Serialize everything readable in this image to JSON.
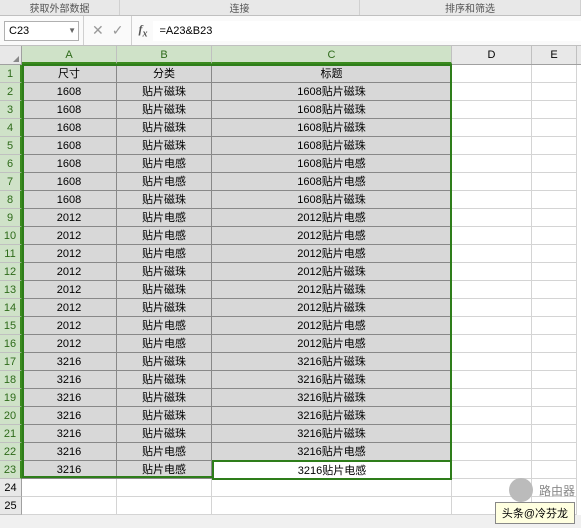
{
  "ribbon": {
    "label1": "获取外部数据",
    "label2": "连接",
    "label3": "排序和筛选"
  },
  "namebox": {
    "value": "C23"
  },
  "formula": {
    "value": "=A23&B23"
  },
  "columns": [
    "A",
    "B",
    "C",
    "D",
    "E"
  ],
  "header_row": {
    "A": "尺寸",
    "B": "分类",
    "C": "标题"
  },
  "rows": [
    {
      "n": 1
    },
    {
      "n": 2,
      "A": "1608",
      "B": "贴片磁珠",
      "C": "1608贴片磁珠"
    },
    {
      "n": 3,
      "A": "1608",
      "B": "贴片磁珠",
      "C": "1608贴片磁珠"
    },
    {
      "n": 4,
      "A": "1608",
      "B": "贴片磁珠",
      "C": "1608贴片磁珠"
    },
    {
      "n": 5,
      "A": "1608",
      "B": "贴片磁珠",
      "C": "1608贴片磁珠"
    },
    {
      "n": 6,
      "A": "1608",
      "B": "贴片电感",
      "C": "1608贴片电感"
    },
    {
      "n": 7,
      "A": "1608",
      "B": "贴片电感",
      "C": "1608贴片电感"
    },
    {
      "n": 8,
      "A": "1608",
      "B": "贴片磁珠",
      "C": "1608贴片磁珠"
    },
    {
      "n": 9,
      "A": "2012",
      "B": "贴片电感",
      "C": "2012贴片电感"
    },
    {
      "n": 10,
      "A": "2012",
      "B": "贴片电感",
      "C": "2012贴片电感"
    },
    {
      "n": 11,
      "A": "2012",
      "B": "贴片电感",
      "C": "2012贴片电感"
    },
    {
      "n": 12,
      "A": "2012",
      "B": "贴片磁珠",
      "C": "2012贴片磁珠"
    },
    {
      "n": 13,
      "A": "2012",
      "B": "贴片磁珠",
      "C": "2012贴片磁珠"
    },
    {
      "n": 14,
      "A": "2012",
      "B": "贴片磁珠",
      "C": "2012贴片磁珠"
    },
    {
      "n": 15,
      "A": "2012",
      "B": "贴片电感",
      "C": "2012贴片电感"
    },
    {
      "n": 16,
      "A": "2012",
      "B": "贴片电感",
      "C": "2012贴片电感"
    },
    {
      "n": 17,
      "A": "3216",
      "B": "贴片磁珠",
      "C": "3216贴片磁珠"
    },
    {
      "n": 18,
      "A": "3216",
      "B": "贴片磁珠",
      "C": "3216贴片磁珠"
    },
    {
      "n": 19,
      "A": "3216",
      "B": "贴片磁珠",
      "C": "3216贴片磁珠"
    },
    {
      "n": 20,
      "A": "3216",
      "B": "贴片磁珠",
      "C": "3216贴片磁珠"
    },
    {
      "n": 21,
      "A": "3216",
      "B": "贴片磁珠",
      "C": "3216贴片磁珠"
    },
    {
      "n": 22,
      "A": "3216",
      "B": "贴片电感",
      "C": "3216贴片电感"
    },
    {
      "n": 23,
      "A": "3216",
      "B": "贴片电感",
      "C": "3216贴片电感"
    },
    {
      "n": 24
    },
    {
      "n": 25
    }
  ],
  "active_cell": {
    "ref": "C23",
    "display": "3216贴片电感"
  },
  "watermark": {
    "text": "路由器",
    "icon": ""
  },
  "tooltip": {
    "text": "头条@冷芬龙"
  }
}
